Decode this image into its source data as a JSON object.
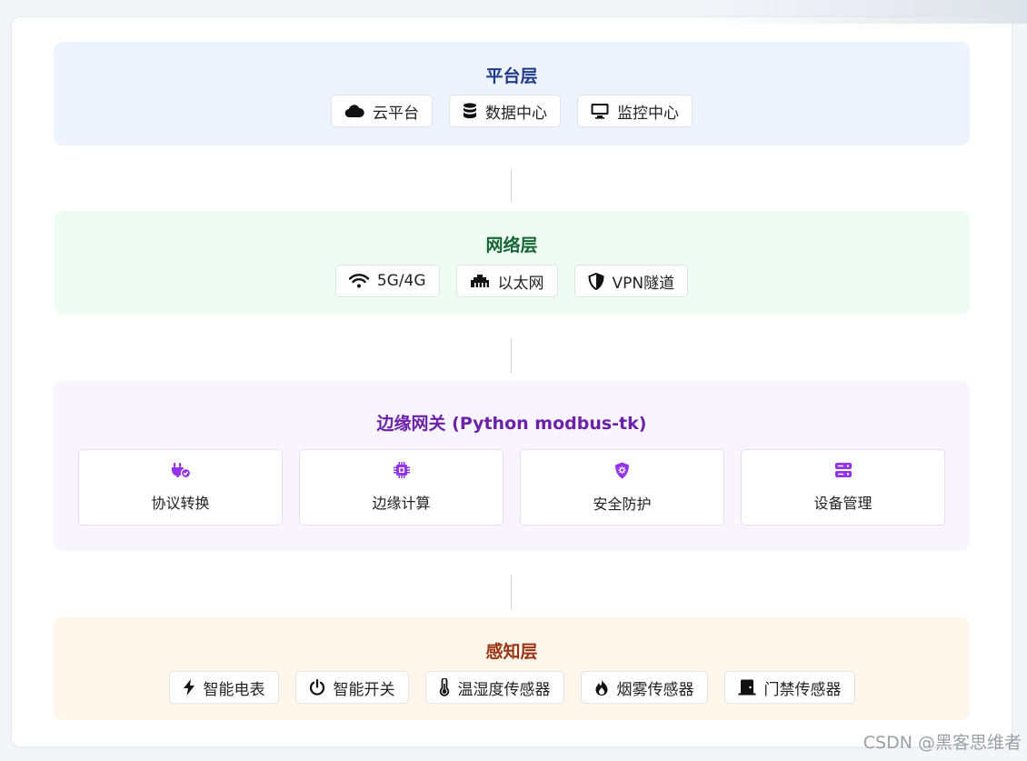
{
  "layers": [
    {
      "title": "平台层",
      "title_color": "#1e3a8a",
      "bg": "#eef4fe",
      "chips": [
        {
          "icon": "cloud-icon",
          "label": "云平台"
        },
        {
          "icon": "database-icon",
          "label": "数据中心"
        },
        {
          "icon": "monitor-icon",
          "label": "监控中心"
        }
      ]
    },
    {
      "title": "网络层",
      "title_color": "#166534",
      "bg": "#effcf3",
      "chips": [
        {
          "icon": "wifi-icon",
          "label": "5G/4G"
        },
        {
          "icon": "ethernet-icon",
          "label": "以太网"
        },
        {
          "icon": "shield-icon",
          "label": "VPN隧道"
        }
      ]
    },
    {
      "title": "边缘网关 (Python modbus-tk)",
      "title_color": "#6b21a8",
      "bg": "#f9f5fe",
      "accent": "#9333ea",
      "boxes": [
        {
          "icon": "plug-icon",
          "label": "协议转换"
        },
        {
          "icon": "chip-icon",
          "label": "边缘计算"
        },
        {
          "icon": "shield-virus-icon",
          "label": "安全防护"
        },
        {
          "icon": "server-icon",
          "label": "设备管理"
        }
      ]
    },
    {
      "title": "感知层",
      "title_color": "#9a3412",
      "bg": "#fff6ec",
      "chips": [
        {
          "icon": "bolt-icon",
          "label": "智能电表"
        },
        {
          "icon": "power-icon",
          "label": "智能开关"
        },
        {
          "icon": "thermometer-icon",
          "label": "温湿度传感器"
        },
        {
          "icon": "fire-icon",
          "label": "烟雾传感器"
        },
        {
          "icon": "door-icon",
          "label": "门禁传感器"
        }
      ]
    }
  ],
  "watermark": "CSDN @黑客思维者"
}
